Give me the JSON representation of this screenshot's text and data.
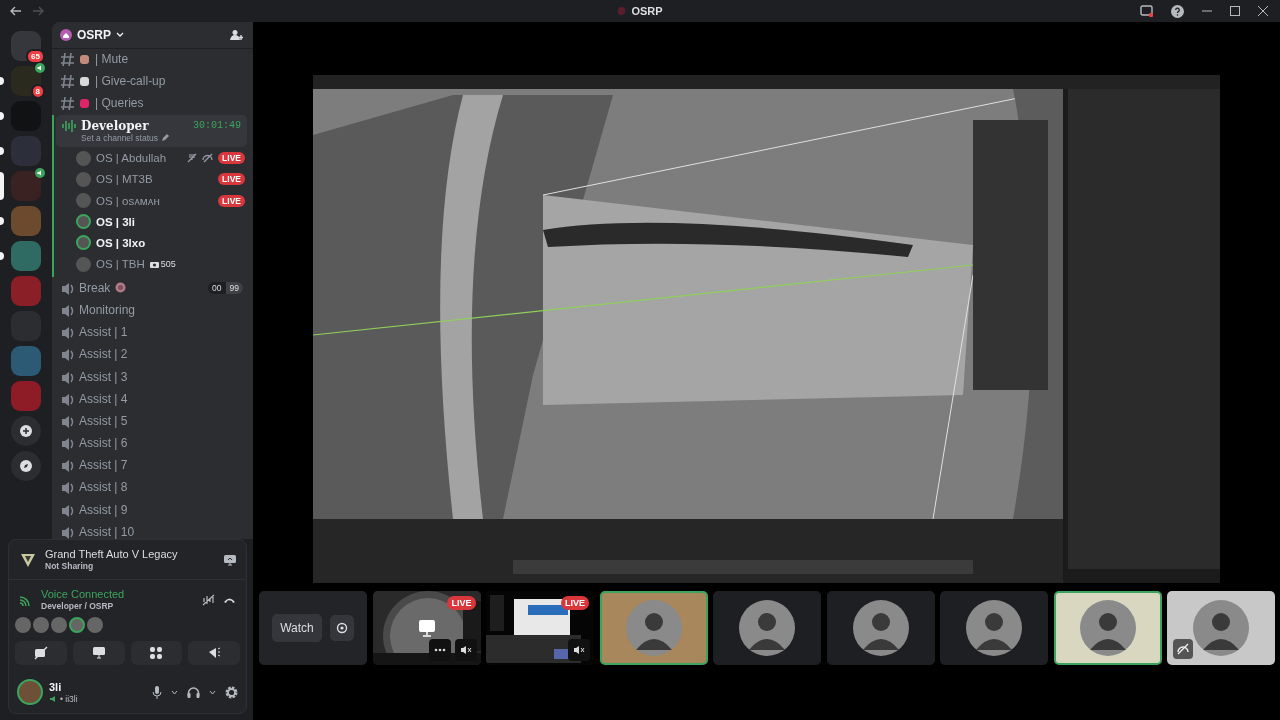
{
  "title_bar": {
    "title": "OSRP"
  },
  "servers": [
    {
      "color": "#35373c",
      "unread": false,
      "badge": "65",
      "speaking": false
    },
    {
      "color": "#2a2a1e",
      "unread": true,
      "badge": "8",
      "speaking": true
    },
    {
      "color": "#111214",
      "unread": true,
      "speaking": false
    },
    {
      "color": "#2c2f3a",
      "unread": true,
      "speaking": false
    },
    {
      "color": "#3a2222",
      "unread": false,
      "speaking": true,
      "selected": true
    },
    {
      "color": "#6b4a2e",
      "unread": true,
      "speaking": false
    },
    {
      "color": "#2f6b63",
      "unread": true,
      "speaking": false
    },
    {
      "color": "#8a1f28",
      "unread": false,
      "speaking": false
    },
    {
      "color": "#2b2d31",
      "unread": false,
      "speaking": false
    },
    {
      "color": "#2c5a74",
      "unread": false,
      "speaking": false
    },
    {
      "color": "#8e1c26",
      "unread": false,
      "speaking": false
    }
  ],
  "server_name": "OSRP",
  "channels": [
    {
      "kind": "text",
      "name": "| Mute",
      "color": "#c48a7a"
    },
    {
      "kind": "text",
      "name": "| Give-call-up",
      "color": "#d9d9d9"
    },
    {
      "kind": "text",
      "name": "| Queries",
      "color": "#e0246a"
    },
    {
      "kind": "voice",
      "name": "Developer",
      "selected": true,
      "timer": "30:01:49",
      "status": "Set a channel status",
      "members": [
        {
          "name": "OS | Abdullah",
          "badge": "LIVE",
          "muted": true,
          "speaking": false
        },
        {
          "name": "OS | MT3B",
          "badge": "LIVE",
          "muted": false,
          "speaking": false
        },
        {
          "name": "OS | ᴏsᴀᴍᴀʜ",
          "badge": "LIVE",
          "muted": false,
          "speaking": false
        },
        {
          "name": "OS | 3li",
          "muted": false,
          "speaking": true
        },
        {
          "name": "OS | 3lxo",
          "muted": false,
          "speaking": true
        },
        {
          "name": "OS | TBH",
          "muted": false,
          "speaking": false,
          "activity": "505"
        }
      ]
    },
    {
      "kind": "voice",
      "name": "Break",
      "selected": false,
      "color": "#b07a88",
      "limit": [
        "00",
        "99"
      ]
    },
    {
      "kind": "voice",
      "name": "Monitoring",
      "selected": false
    },
    {
      "kind": "voice",
      "name": "Assist | 1",
      "selected": false
    },
    {
      "kind": "voice",
      "name": "Assist | 2",
      "selected": false
    },
    {
      "kind": "voice",
      "name": "Assist | 3",
      "selected": false
    },
    {
      "kind": "voice",
      "name": "Assist | 4",
      "selected": false
    },
    {
      "kind": "voice",
      "name": "Assist | 5",
      "selected": false
    },
    {
      "kind": "voice",
      "name": "Assist | 6",
      "selected": false
    },
    {
      "kind": "voice",
      "name": "Assist | 7",
      "selected": false
    },
    {
      "kind": "voice",
      "name": "Assist | 8",
      "selected": false
    },
    {
      "kind": "voice",
      "name": "Assist | 9",
      "selected": false
    },
    {
      "kind": "voice",
      "name": "Assist | 10",
      "selected": false
    }
  ],
  "activity": {
    "game": "Grand Theft Auto V Legacy",
    "status": "Not Sharing"
  },
  "voice": {
    "title": "Voice Connected",
    "location": "Developer / OSRP",
    "participants": [
      {
        "speaking": false
      },
      {
        "speaking": false
      },
      {
        "speaking": false
      },
      {
        "speaking": true
      },
      {
        "speaking": false
      }
    ]
  },
  "user": {
    "name": "3li",
    "tag": "• ii3li"
  },
  "tiles": [
    {
      "kind": "watch",
      "label": "Watch"
    },
    {
      "kind": "stream",
      "live": true,
      "label": "LIVE"
    },
    {
      "kind": "stream",
      "live": true,
      "label": "LIVE"
    },
    {
      "kind": "avatar",
      "speaking": true,
      "color": "#a8875c",
      "muted": false
    },
    {
      "kind": "avatar",
      "speaking": false,
      "color": "#1e1f22",
      "muted": false
    },
    {
      "kind": "avatar",
      "speaking": false,
      "color": "#1e1f22",
      "muted": false
    },
    {
      "kind": "avatar",
      "speaking": false,
      "color": "#1e1f22",
      "muted": false
    },
    {
      "kind": "avatar",
      "speaking": true,
      "color": "#d9d7c0",
      "muted": false
    },
    {
      "kind": "avatar",
      "speaking": false,
      "color": "#c8c8c8",
      "muted": true
    }
  ]
}
